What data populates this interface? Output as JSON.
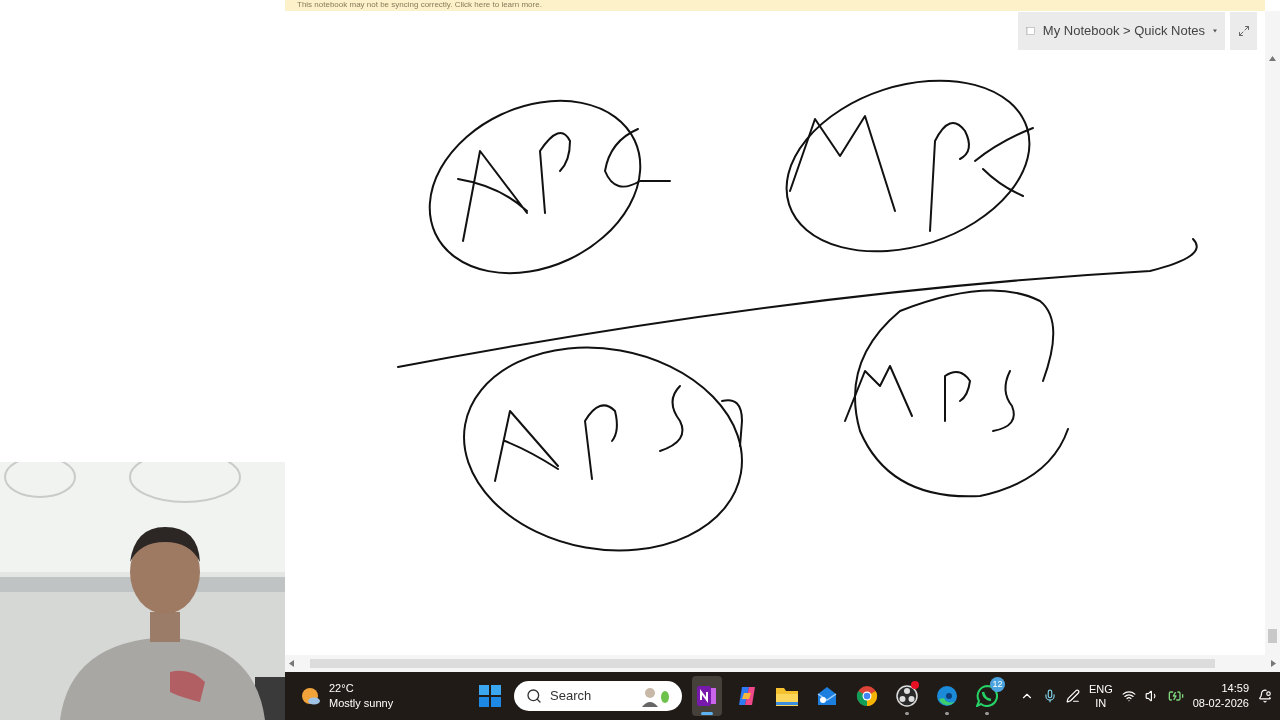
{
  "sync_banner": {
    "text": "This notebook may not be syncing correctly. Click here to learn more."
  },
  "breadcrumb": {
    "text": "My Notebook > Quick Notes"
  },
  "taskbar": {
    "weather": {
      "temperature": "22°C",
      "condition": "Mostly sunny"
    },
    "search": {
      "placeholder": "Search"
    },
    "apps": [
      {
        "kind": "windows"
      },
      {
        "kind": "onenote",
        "running": true,
        "active": true
      },
      {
        "kind": "copilot",
        "running": false,
        "active": false
      },
      {
        "kind": "explorer",
        "running": false,
        "active": false
      },
      {
        "kind": "outlook",
        "running": false,
        "active": false
      },
      {
        "kind": "chrome",
        "running": false,
        "active": false
      },
      {
        "kind": "obs",
        "running": true,
        "active": false,
        "alert": true
      },
      {
        "kind": "edge",
        "running": true,
        "active": false
      },
      {
        "kind": "whatsapp",
        "running": true,
        "active": false,
        "badge": "12"
      }
    ],
    "language": [
      "ENG",
      "IN"
    ],
    "time": "14:59",
    "date": "08-02-2026"
  }
}
